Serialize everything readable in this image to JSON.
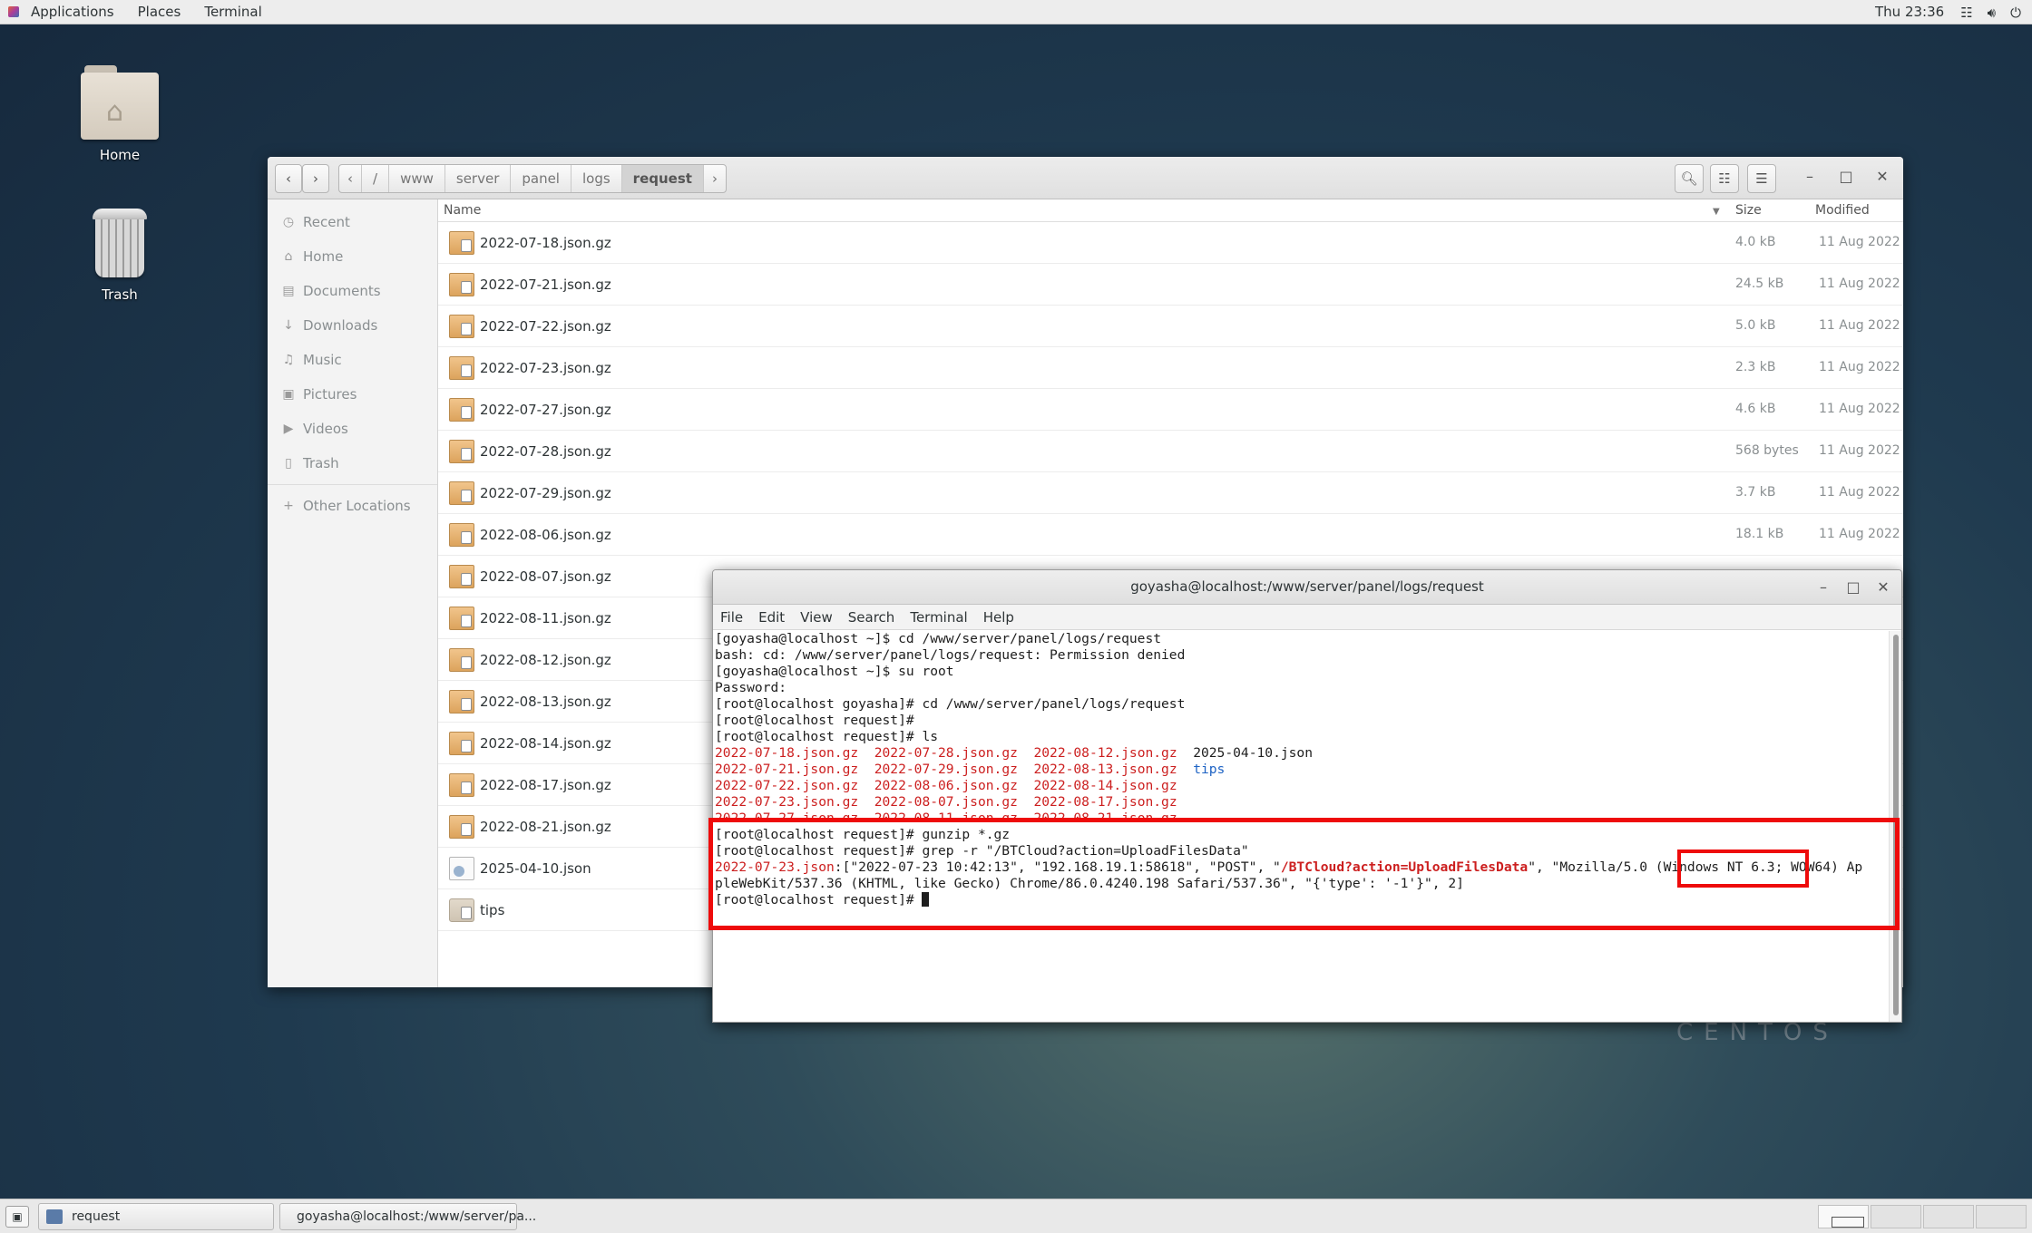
{
  "topbar": {
    "menus": [
      "Applications",
      "Places",
      "Terminal"
    ],
    "clock": "Thu 23:36",
    "tray_icons": [
      "network-icon",
      "volume-icon",
      "power-icon"
    ]
  },
  "desktop": {
    "icons": [
      {
        "label": "Home",
        "icon": "home-folder-icon"
      },
      {
        "label": "Trash",
        "icon": "trash-icon"
      }
    ],
    "watermark": "CENTOS"
  },
  "file_manager": {
    "path": [
      "/",
      "www",
      "server",
      "panel",
      "logs",
      "request"
    ],
    "active_segment": "request",
    "sidebar": [
      {
        "label": "Recent",
        "icon": "clock-icon"
      },
      {
        "label": "Home",
        "icon": "home-icon"
      },
      {
        "label": "Documents",
        "icon": "document-icon"
      },
      {
        "label": "Downloads",
        "icon": "download-icon"
      },
      {
        "label": "Music",
        "icon": "music-icon"
      },
      {
        "label": "Pictures",
        "icon": "camera-icon"
      },
      {
        "label": "Videos",
        "icon": "video-icon"
      },
      {
        "label": "Trash",
        "icon": "trash-icon"
      },
      {
        "label": "Other Locations",
        "icon": "plus-icon"
      }
    ],
    "columns": {
      "name": "Name",
      "size": "Size",
      "modified": "Modified"
    },
    "files": [
      {
        "name": "2022-07-18.json.gz",
        "size": "4.0 kB",
        "modified": "11 Aug 2022",
        "type": "archive"
      },
      {
        "name": "2022-07-21.json.gz",
        "size": "24.5 kB",
        "modified": "11 Aug 2022",
        "type": "archive"
      },
      {
        "name": "2022-07-22.json.gz",
        "size": "5.0 kB",
        "modified": "11 Aug 2022",
        "type": "archive"
      },
      {
        "name": "2022-07-23.json.gz",
        "size": "2.3 kB",
        "modified": "11 Aug 2022",
        "type": "archive"
      },
      {
        "name": "2022-07-27.json.gz",
        "size": "4.6 kB",
        "modified": "11 Aug 2022",
        "type": "archive"
      },
      {
        "name": "2022-07-28.json.gz",
        "size": "568 bytes",
        "modified": "11 Aug 2022",
        "type": "archive"
      },
      {
        "name": "2022-07-29.json.gz",
        "size": "3.7 kB",
        "modified": "11 Aug 2022",
        "type": "archive"
      },
      {
        "name": "2022-08-06.json.gz",
        "size": "18.1 kB",
        "modified": "11 Aug 2022",
        "type": "archive"
      },
      {
        "name": "2022-08-07.json.gz",
        "size": "",
        "modified": "",
        "type": "archive"
      },
      {
        "name": "2022-08-11.json.gz",
        "size": "",
        "modified": "",
        "type": "archive"
      },
      {
        "name": "2022-08-12.json.gz",
        "size": "",
        "modified": "",
        "type": "archive"
      },
      {
        "name": "2022-08-13.json.gz",
        "size": "",
        "modified": "",
        "type": "archive"
      },
      {
        "name": "2022-08-14.json.gz",
        "size": "",
        "modified": "",
        "type": "archive"
      },
      {
        "name": "2022-08-17.json.gz",
        "size": "",
        "modified": "",
        "type": "archive"
      },
      {
        "name": "2022-08-21.json.gz",
        "size": "",
        "modified": "",
        "type": "archive"
      },
      {
        "name": "2025-04-10.json",
        "size": "",
        "modified": "",
        "type": "document"
      },
      {
        "name": "tips",
        "size": "",
        "modified": "",
        "type": "folder"
      }
    ]
  },
  "terminal": {
    "title": "goyasha@localhost:/www/server/panel/logs/request",
    "menus": [
      "File",
      "Edit",
      "View",
      "Search",
      "Terminal",
      "Help"
    ],
    "lines": {
      "l1": "[goyasha@localhost ~]$ cd /www/server/panel/logs/request",
      "l2": "bash: cd: /www/server/panel/logs/request: Permission denied",
      "l3": "[goyasha@localhost ~]$ su root",
      "l4": "Password:",
      "l5": "[root@localhost goyasha]# cd /www/server/panel/logs/request",
      "l6": "[root@localhost request]#",
      "l7": "[root@localhost request]# ls",
      "ls_r1": [
        "2022-07-18.json.gz",
        "2022-07-28.json.gz",
        "2022-08-12.json.gz",
        "2025-04-10.json"
      ],
      "ls_r2": [
        "2022-07-21.json.gz",
        "2022-07-29.json.gz",
        "2022-08-13.json.gz",
        "tips"
      ],
      "ls_r3": [
        "2022-07-22.json.gz",
        "2022-08-06.json.gz",
        "2022-08-14.json.gz"
      ],
      "ls_r4": [
        "2022-07-23.json.gz",
        "2022-08-07.json.gz",
        "2022-08-17.json.gz"
      ],
      "ls_r5": [
        "2022-07-27.json.gz",
        "2022-08-11.json.gz",
        "2022-08-21.json.gz"
      ],
      "l8": "[root@localhost request]# gunzip *.gz",
      "l9": "[root@localhost request]# grep -r \"/BTCloud?action=UploadFilesData\"",
      "g_file": "2022-07-23.json",
      "g_pre": ":[\"2022-07-23 10:42:13\", \"192.168.19.1:58618\", \"POST\", \"",
      "g_match": "/BTCloud?action=UploadFilesData",
      "g_post": "\", \"Mozilla/5.0 (Windows NT 6.3; WOW64) Ap",
      "g_cont": "pleWebKit/537.36 (KHTML, like Gecko) Chrome/86.0.4240.198 Safari/537.36\", \"{'type': '-1'}\", 2]",
      "prompt": "[root@localhost request]# "
    }
  },
  "taskbar": {
    "tasks": [
      {
        "label": "request"
      },
      {
        "label": "goyasha@localhost:/www/server/pa..."
      }
    ],
    "workspaces": 4,
    "active_workspace": 1
  }
}
